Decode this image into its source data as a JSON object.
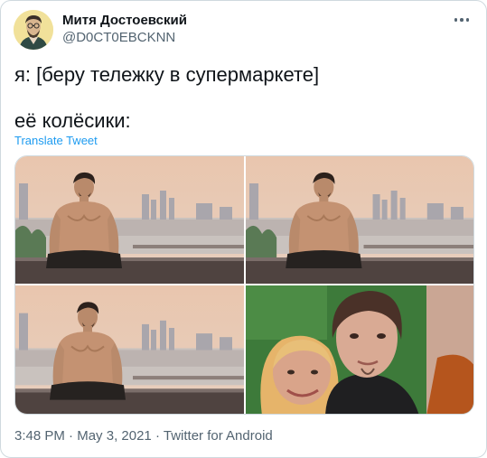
{
  "tweet": {
    "author_name": "Митя Достоевский",
    "author_handle": "@D0CT0EBCKNN",
    "text_line1": "я: [беру тележку в супермаркете]",
    "text_line2": "её колёсики:",
    "translate_label": "Translate Tweet",
    "time": "3:48 PM",
    "date": "May 3, 2021",
    "source": "Twitter for Android",
    "separator": "·"
  },
  "media": {
    "count": 4,
    "items": [
      "photo-man-seated-sunset",
      "photo-man-seated-sunset",
      "photo-man-seated-sunset",
      "photo-selfie-couple"
    ]
  },
  "colors": {
    "text_primary": "#0f1419",
    "text_secondary": "#536471",
    "link": "#1d9bf0",
    "border": "#cfd9de"
  },
  "icons": {
    "more": "more-horizontal-icon"
  }
}
